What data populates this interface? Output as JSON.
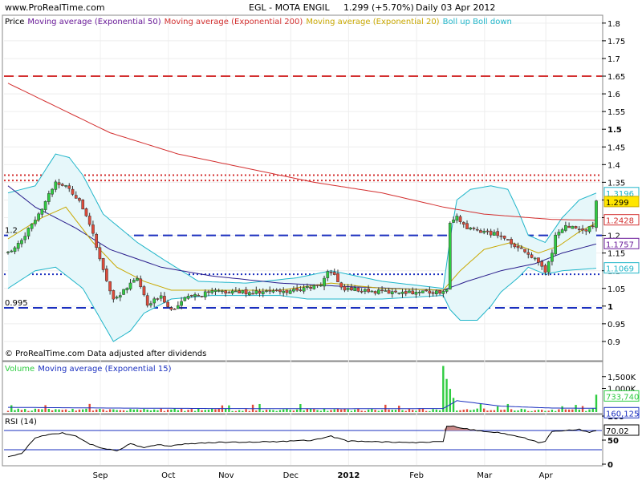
{
  "header": {
    "site": "www.ProRealTime.com",
    "instrument": "EGL - MOTA ENGIL",
    "quote": "1.299 (+5.70%)",
    "period": "Daily  03 Apr 2012"
  },
  "footer_note": "© ProRealTime.com  Data adjusted after dividends",
  "chart_data": [
    {
      "type": "candlestick",
      "panel": "price",
      "legend": [
        {
          "label": "Price",
          "color": "#000000"
        },
        {
          "label": "Moving average (Exponential 50)",
          "color": "#6a1b9a"
        },
        {
          "label": "Moving average (Exponential 200)",
          "color": "#d32f2f"
        },
        {
          "label": "Moving average (Exponential 20)",
          "color": "#c9a800"
        },
        {
          "label": "Boll up Boll down",
          "color": "#1fb5c9"
        }
      ],
      "ylim": [
        0.85,
        1.82
      ],
      "y_ticks": [
        "1.8",
        "1.75",
        "1.7",
        "1.65",
        "1.6",
        "1.55",
        "1.5",
        "1.45",
        "1.4",
        "1.35",
        "1.3",
        "1.25",
        "1.2",
        "1.15",
        "1.1",
        "1.05",
        "1",
        "0.95",
        "0.9"
      ],
      "x_labels": [
        "Sep",
        "Oct",
        "Nov",
        "Dec",
        "2012",
        "Feb",
        "Mar",
        "Apr"
      ],
      "level_labels": [
        "1.2",
        "0.995"
      ],
      "value_badges": [
        {
          "text": "1.3196",
          "color": "#1fb5c9"
        },
        {
          "text": "1.299",
          "color": "#c9a800"
        },
        {
          "text": "1.2428",
          "color": "#d32f2f"
        },
        {
          "text": "1.1757",
          "color": "#6a1b9a"
        },
        {
          "text": "1.1069",
          "color": "#1fb5c9"
        }
      ],
      "horizontal_levels": [
        {
          "value": 1.65,
          "color": "#d32f2f",
          "style": "dashed"
        },
        {
          "value": 1.37,
          "color": "#d32f2f",
          "style": "dotted"
        },
        {
          "value": 1.355,
          "color": "#d32f2f",
          "style": "dotted"
        },
        {
          "value": 1.2,
          "color": "#1a2fbf",
          "style": "dashed"
        },
        {
          "value": 1.09,
          "color": "#1a2fbf",
          "style": "dotted"
        },
        {
          "value": 0.995,
          "color": "#1a2fbf",
          "style": "dashed"
        }
      ],
      "ohlc_keys": [
        [
          0,
          1.15
        ],
        [
          5,
          1.2
        ],
        [
          10,
          1.28
        ],
        [
          14,
          1.35
        ],
        [
          17,
          1.34
        ],
        [
          21,
          1.3
        ],
        [
          25,
          1.2
        ],
        [
          28,
          1.1
        ],
        [
          31,
          1.02
        ],
        [
          35,
          1.05
        ],
        [
          38,
          1.08
        ],
        [
          41,
          1.0
        ],
        [
          45,
          1.03
        ],
        [
          48,
          0.99
        ],
        [
          52,
          1.02
        ],
        [
          56,
          1.03
        ],
        [
          60,
          1.04
        ],
        [
          70,
          1.04
        ],
        [
          80,
          1.04
        ],
        [
          88,
          1.05
        ],
        [
          92,
          1.06
        ],
        [
          94,
          1.1
        ],
        [
          96,
          1.09
        ],
        [
          98,
          1.05
        ],
        [
          110,
          1.04
        ],
        [
          120,
          1.04
        ],
        [
          128,
          1.04
        ],
        [
          129,
          1.05
        ],
        [
          130,
          1.24
        ],
        [
          132,
          1.25
        ],
        [
          135,
          1.22
        ],
        [
          140,
          1.21
        ],
        [
          145,
          1.2
        ],
        [
          150,
          1.16
        ],
        [
          153,
          1.15
        ],
        [
          156,
          1.12
        ],
        [
          158,
          1.1
        ],
        [
          160,
          1.15
        ],
        [
          161,
          1.2
        ],
        [
          163,
          1.22
        ],
        [
          166,
          1.23
        ],
        [
          170,
          1.21
        ],
        [
          172,
          1.23
        ],
        [
          173,
          1.299
        ]
      ],
      "ema50_keys": [
        [
          0,
          1.34
        ],
        [
          8,
          1.28
        ],
        [
          20,
          1.22
        ],
        [
          30,
          1.16
        ],
        [
          45,
          1.11
        ],
        [
          60,
          1.085
        ],
        [
          80,
          1.065
        ],
        [
          100,
          1.055
        ],
        [
          128,
          1.045
        ],
        [
          135,
          1.07
        ],
        [
          145,
          1.1
        ],
        [
          155,
          1.12
        ],
        [
          163,
          1.15
        ],
        [
          173,
          1.1757
        ]
      ],
      "ema200_keys": [
        [
          0,
          1.63
        ],
        [
          15,
          1.56
        ],
        [
          30,
          1.49
        ],
        [
          50,
          1.43
        ],
        [
          70,
          1.39
        ],
        [
          90,
          1.35
        ],
        [
          110,
          1.32
        ],
        [
          128,
          1.28
        ],
        [
          140,
          1.26
        ],
        [
          160,
          1.245
        ],
        [
          173,
          1.2428
        ]
      ],
      "ema20_keys": [
        [
          0,
          1.19
        ],
        [
          10,
          1.25
        ],
        [
          17,
          1.28
        ],
        [
          25,
          1.18
        ],
        [
          32,
          1.11
        ],
        [
          40,
          1.07
        ],
        [
          48,
          1.045
        ],
        [
          60,
          1.045
        ],
        [
          80,
          1.045
        ],
        [
          95,
          1.065
        ],
        [
          110,
          1.05
        ],
        [
          128,
          1.045
        ],
        [
          133,
          1.1
        ],
        [
          140,
          1.16
        ],
        [
          148,
          1.18
        ],
        [
          156,
          1.15
        ],
        [
          162,
          1.17
        ],
        [
          168,
          1.21
        ],
        [
          173,
          1.235
        ]
      ],
      "boll_up_keys": [
        [
          0,
          1.32
        ],
        [
          8,
          1.34
        ],
        [
          14,
          1.43
        ],
        [
          18,
          1.42
        ],
        [
          22,
          1.37
        ],
        [
          28,
          1.26
        ],
        [
          38,
          1.18
        ],
        [
          46,
          1.13
        ],
        [
          56,
          1.07
        ],
        [
          70,
          1.065
        ],
        [
          85,
          1.08
        ],
        [
          95,
          1.1
        ],
        [
          110,
          1.07
        ],
        [
          128,
          1.05
        ],
        [
          130,
          1.19
        ],
        [
          132,
          1.3
        ],
        [
          136,
          1.33
        ],
        [
          142,
          1.34
        ],
        [
          147,
          1.33
        ],
        [
          150,
          1.27
        ],
        [
          153,
          1.2
        ],
        [
          158,
          1.18
        ],
        [
          163,
          1.25
        ],
        [
          168,
          1.3
        ],
        [
          173,
          1.3196
        ]
      ],
      "boll_down_keys": [
        [
          0,
          1.05
        ],
        [
          8,
          1.1
        ],
        [
          14,
          1.11
        ],
        [
          18,
          1.08
        ],
        [
          22,
          1.05
        ],
        [
          28,
          0.95
        ],
        [
          31,
          0.9
        ],
        [
          36,
          0.93
        ],
        [
          40,
          0.98
        ],
        [
          48,
          1.02
        ],
        [
          60,
          1.03
        ],
        [
          80,
          1.03
        ],
        [
          88,
          1.02
        ],
        [
          95,
          1.02
        ],
        [
          110,
          1.02
        ],
        [
          128,
          1.03
        ],
        [
          130,
          0.99
        ],
        [
          133,
          0.96
        ],
        [
          138,
          0.96
        ],
        [
          142,
          1.0
        ],
        [
          145,
          1.04
        ],
        [
          150,
          1.08
        ],
        [
          153,
          1.11
        ],
        [
          158,
          1.09
        ],
        [
          163,
          1.1
        ],
        [
          173,
          1.1069
        ]
      ]
    },
    {
      "type": "bar",
      "panel": "volume",
      "legend": [
        {
          "label": "Volume",
          "color": "#2ecc40"
        },
        {
          "label": "Moving average (Exponential 15)",
          "color": "#1a2fbf"
        }
      ],
      "ylim": [
        0,
        2000000
      ],
      "y_ticks": [
        "1,500K",
        "1,000K"
      ],
      "value_badges": [
        {
          "text": "733,740",
          "color": "#2ecc40"
        },
        {
          "text": "160,125",
          "color": "#1a2fbf"
        }
      ],
      "spikes": [
        [
          128,
          1950000
        ],
        [
          129,
          1400000
        ],
        [
          130,
          980000
        ],
        [
          131,
          600000
        ],
        [
          173,
          733740
        ]
      ],
      "ema_keys": [
        [
          0,
          200000
        ],
        [
          30,
          170000
        ],
        [
          60,
          150000
        ],
        [
          100,
          140000
        ],
        [
          128,
          150000
        ],
        [
          132,
          480000
        ],
        [
          145,
          250000
        ],
        [
          160,
          170000
        ],
        [
          173,
          160125
        ]
      ]
    },
    {
      "type": "line",
      "panel": "rsi",
      "legend": [
        {
          "label": "RSI (14)",
          "color": "#000000"
        }
      ],
      "ylim": [
        0,
        100
      ],
      "y_ticks": [
        "100",
        "50",
        "0"
      ],
      "value_badges": [
        {
          "text": "70.02",
          "color": "#000000"
        }
      ],
      "levels": [
        70,
        30
      ],
      "keys": [
        [
          0,
          16
        ],
        [
          4,
          22
        ],
        [
          8,
          55
        ],
        [
          12,
          62
        ],
        [
          16,
          65
        ],
        [
          20,
          58
        ],
        [
          24,
          42
        ],
        [
          28,
          32
        ],
        [
          32,
          28
        ],
        [
          36,
          42
        ],
        [
          40,
          35
        ],
        [
          44,
          40
        ],
        [
          48,
          38
        ],
        [
          52,
          42
        ],
        [
          60,
          45
        ],
        [
          70,
          46
        ],
        [
          80,
          47
        ],
        [
          90,
          50
        ],
        [
          95,
          58
        ],
        [
          100,
          48
        ],
        [
          110,
          46
        ],
        [
          120,
          45
        ],
        [
          128,
          47
        ],
        [
          129,
          78
        ],
        [
          131,
          80
        ],
        [
          133,
          75
        ],
        [
          138,
          70
        ],
        [
          145,
          65
        ],
        [
          152,
          54
        ],
        [
          156,
          45
        ],
        [
          158,
          48
        ],
        [
          160,
          68
        ],
        [
          164,
          70
        ],
        [
          168,
          72
        ],
        [
          171,
          66
        ],
        [
          173,
          70.02
        ]
      ]
    }
  ]
}
